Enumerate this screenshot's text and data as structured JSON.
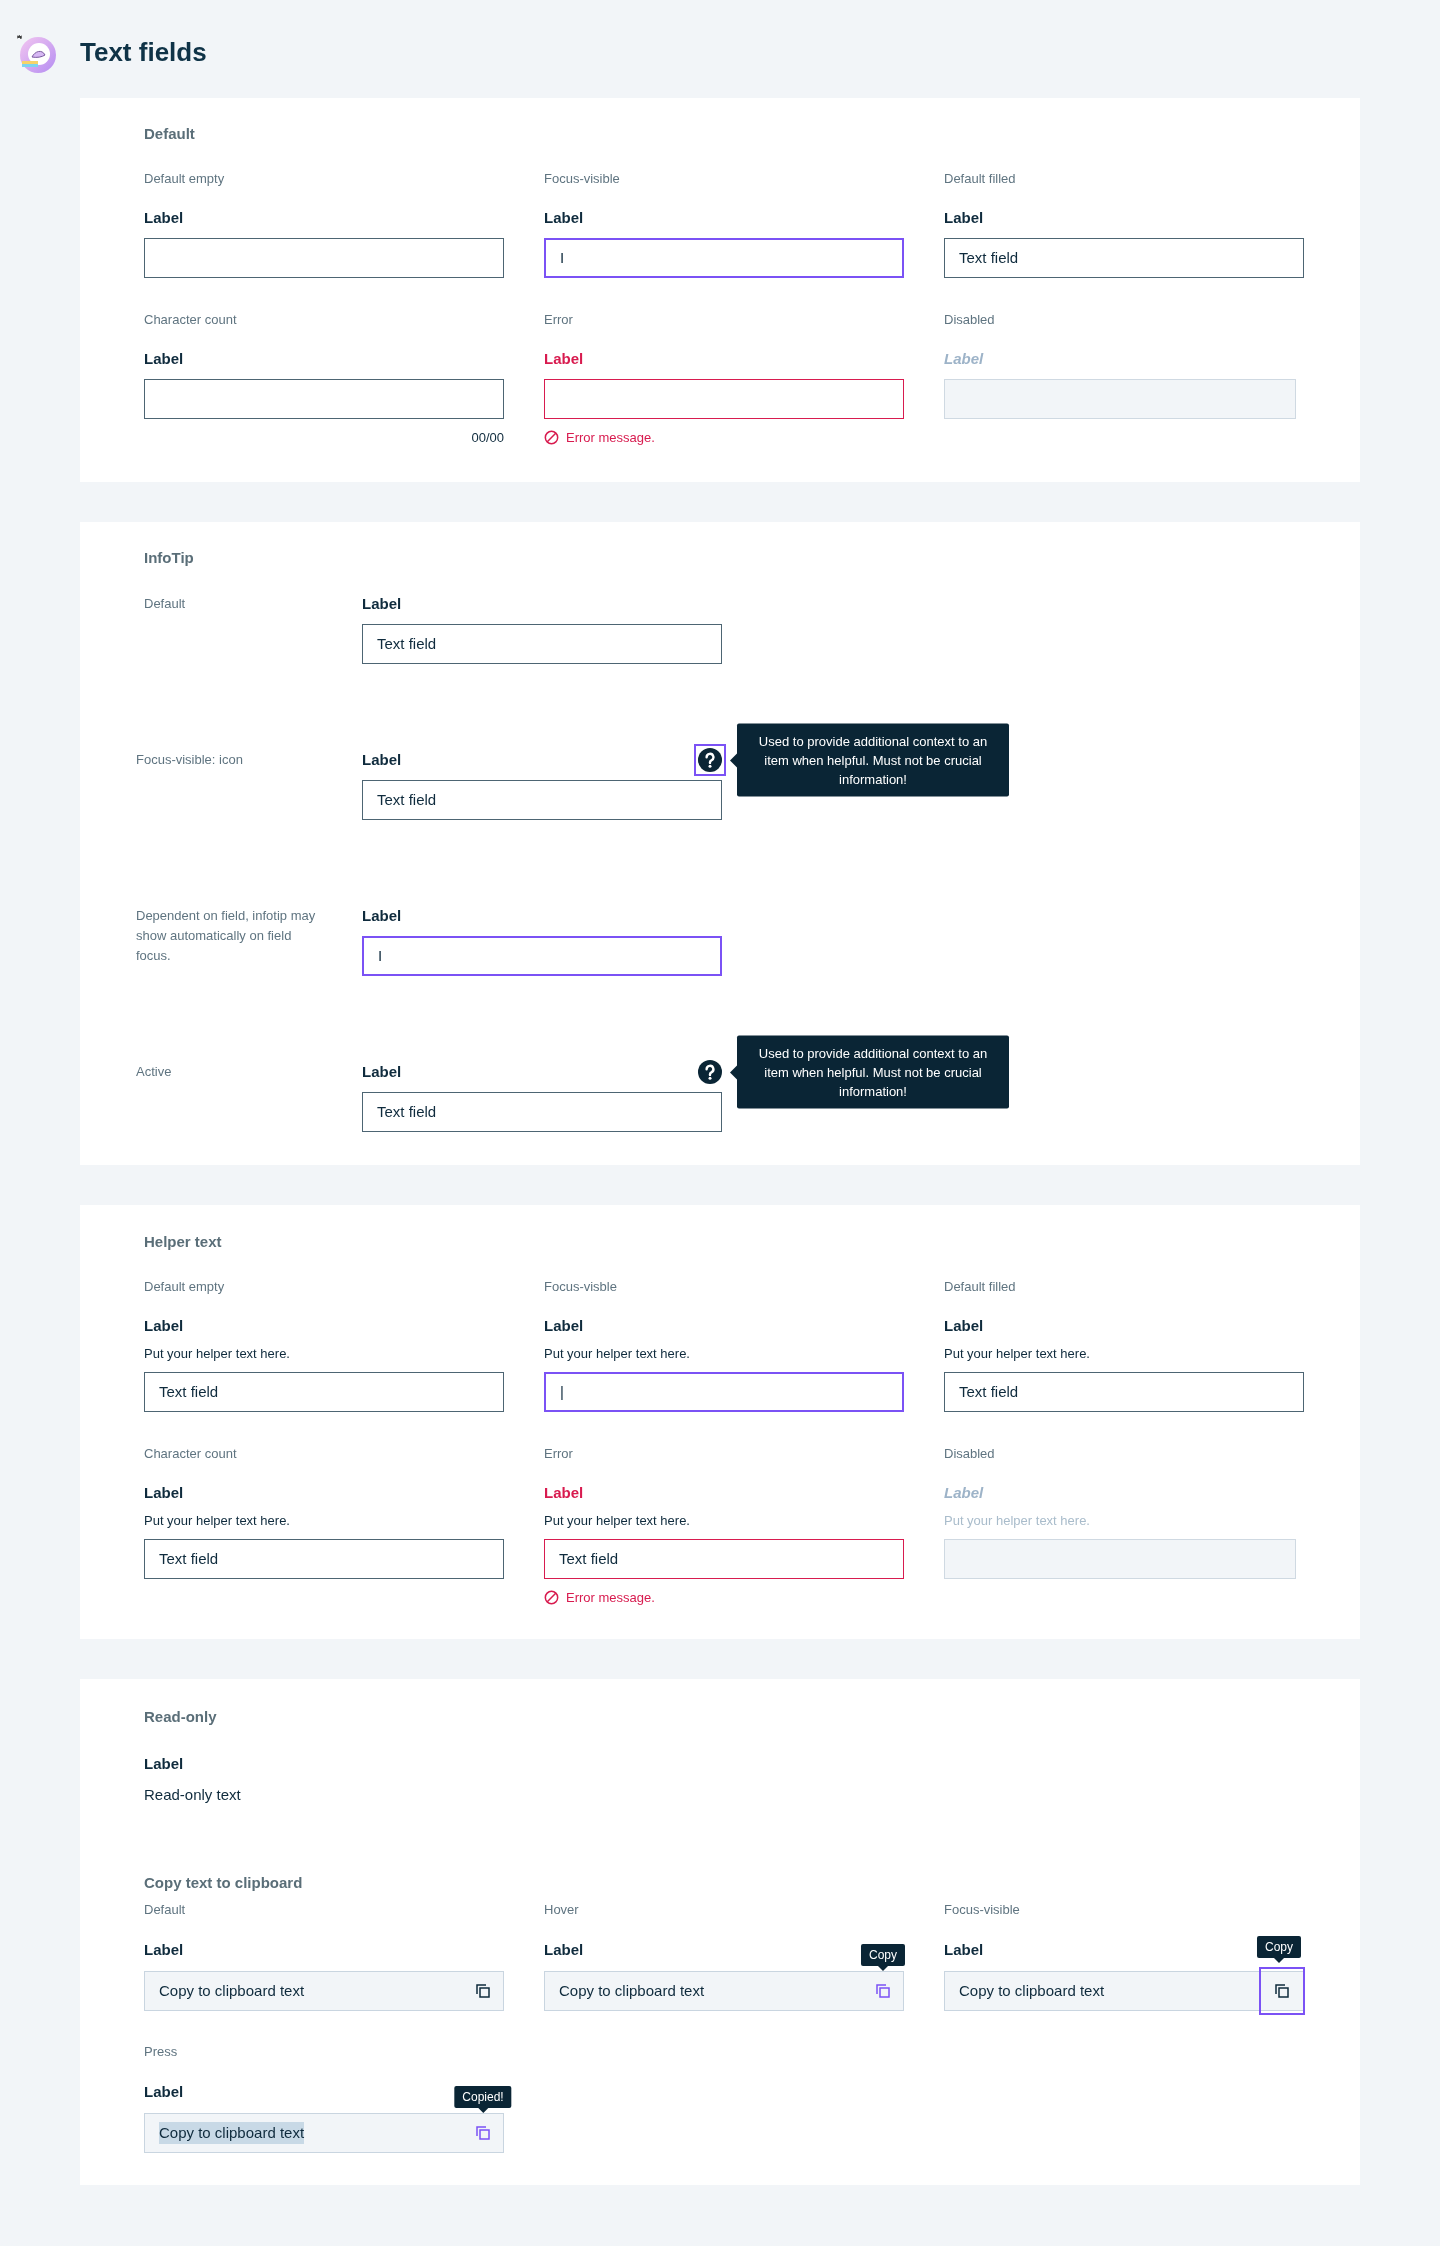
{
  "page": {
    "title": "Text fields"
  },
  "cards": [
    {
      "blocks": [
        {
          "kind": "grid",
          "title": "Default",
          "items": [
            {
              "caption": "Default empty",
              "label": "Label",
              "kind": "default"
            },
            {
              "caption": "Focus-visible",
              "label": "Label",
              "kind": "focus",
              "value": "I"
            },
            {
              "caption": "Default filled",
              "label": "Label",
              "kind": "default",
              "value": "Text field"
            },
            {
              "caption": "Character count",
              "label": "Label",
              "kind": "default",
              "count": "00/00"
            },
            {
              "caption": "Error",
              "label": "Label",
              "kind": "error",
              "error_message": "Error message."
            },
            {
              "caption": "Disabled",
              "label": "Label",
              "kind": "disabled"
            }
          ]
        }
      ]
    },
    {
      "blocks": [
        {
          "kind": "infotip",
          "title": "InfoTip",
          "rows": [
            {
              "caption": "Default",
              "label": "Label",
              "kind": "default",
              "value": "Text field"
            },
            {
              "caption": "Focus-visible: icon",
              "label": "Label",
              "kind": "default",
              "value": "Text field",
              "infotip": {
                "focused": true,
                "text": "Used to provide additional context to an item when helpful. Must not be crucial information!"
              }
            },
            {
              "caption": "Dependent on field, infotip may show automatically on field focus.",
              "label": "Label",
              "kind": "focus",
              "value": "I"
            },
            {
              "caption": "Active",
              "label": "Label",
              "kind": "default",
              "value": "Text field",
              "infotip": {
                "focused": false,
                "text": "Used to provide additional context to an item when helpful. Must not be crucial information!"
              }
            }
          ]
        }
      ]
    },
    {
      "blocks": [
        {
          "kind": "grid",
          "title": "Helper text",
          "items": [
            {
              "caption": "Default empty",
              "label": "Label",
              "helper": "Put your helper text here.",
              "kind": "default",
              "value": "Text field"
            },
            {
              "caption": "Focus-visble",
              "label": "Label",
              "helper": "Put your helper text here.",
              "kind": "focus",
              "value": "|"
            },
            {
              "caption": "Default filled",
              "label": "Label",
              "helper": "Put your helper text here.",
              "kind": "default",
              "value": "Text field"
            },
            {
              "caption": "Character count",
              "label": "Label",
              "helper": "Put your helper text here.",
              "kind": "default",
              "value": "Text field"
            },
            {
              "caption": "Error",
              "label": "Label",
              "helper": "Put your helper text here.",
              "kind": "error",
              "value": "Text field",
              "error_message": "Error message."
            },
            {
              "caption": "Disabled",
              "label": "Label",
              "helper": "Put your helper text here.",
              "kind": "disabled"
            }
          ]
        }
      ]
    },
    {
      "blocks": [
        {
          "kind": "readonly",
          "title": "Read-only",
          "label": "Label",
          "value": "Read-only text"
        },
        {
          "kind": "copy",
          "title": "Copy text to clipboard",
          "items": [
            {
              "caption": "Default",
              "label": "Label",
              "value": "Copy to clipboard text",
              "kind": "default"
            },
            {
              "caption": "Hover",
              "label": "Label",
              "value": "Copy to clipboard text",
              "kind": "hover",
              "tooltip": "Copy"
            },
            {
              "caption": "Focus-visible",
              "label": "Label",
              "value": "Copy to clipboard text",
              "kind": "focus",
              "tooltip": "Copy"
            },
            {
              "caption": "Press",
              "label": "Label",
              "value": "Copy to clipboard text",
              "kind": "press",
              "tooltip": "Copied!"
            }
          ]
        }
      ]
    }
  ]
}
